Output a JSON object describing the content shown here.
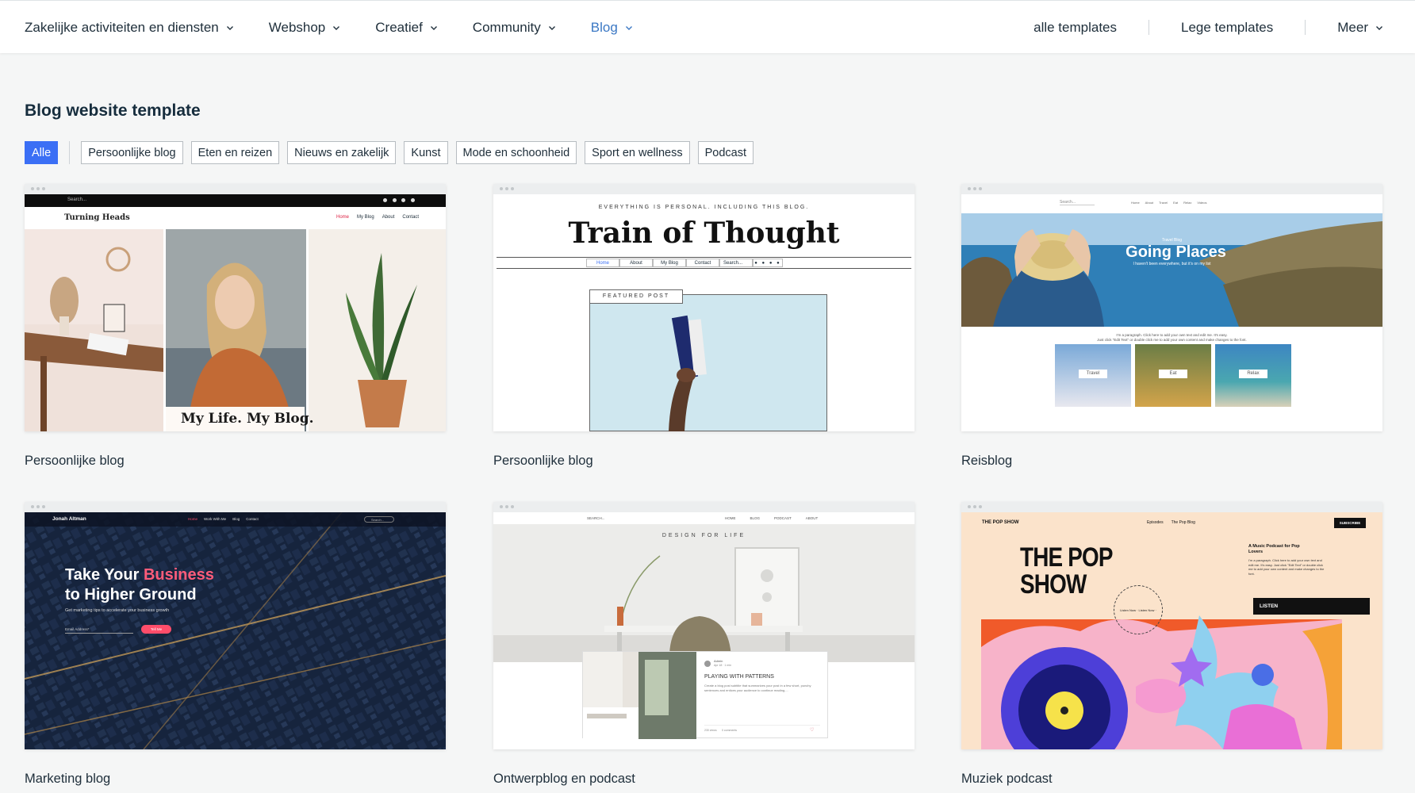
{
  "nav": {
    "items": [
      {
        "label": "Zakelijke activiteiten en diensten"
      },
      {
        "label": "Webshop"
      },
      {
        "label": "Creatief"
      },
      {
        "label": "Community"
      },
      {
        "label": "Blog"
      }
    ],
    "active_index": 4,
    "right": {
      "all_templates": "alle templates",
      "blank_templates": "Lege templates",
      "more": "Meer"
    }
  },
  "colors": {
    "active_nav": "#3b78c4",
    "selected_chip": "#3b6ff5",
    "page_bg": "#f5f6f6"
  },
  "page": {
    "title": "Blog website template"
  },
  "filters": {
    "selected": "Alle",
    "items": [
      "Persoonlijke blog",
      "Eten en reizen",
      "Nieuws en zakelijk",
      "Kunst",
      "Mode en schoonheid",
      "Sport en wellness",
      "Podcast"
    ]
  },
  "templates": [
    {
      "label": "Persoonlijke blog",
      "preview": {
        "search": "Search...",
        "site_name": "Turning Heads",
        "menu": [
          "Home",
          "My Blog",
          "About",
          "Contact"
        ],
        "tagline": "My Life. My Blog."
      }
    },
    {
      "label": "Persoonlijke blog",
      "preview": {
        "kicker": "EVERYTHING IS PERSONAL. INCLUDING THIS BLOG.",
        "title": "Train of Thought",
        "menu": [
          "Home",
          "About",
          "My Blog",
          "Contact",
          "Search..."
        ],
        "featured": "FEATURED POST"
      }
    },
    {
      "label": "Reisblog",
      "preview": {
        "search": "Search...",
        "menu": [
          "Home",
          "About",
          "Travel",
          "Eat",
          "Relax",
          "Videos"
        ],
        "small": "Travel Blog",
        "title": "Going Places",
        "subtitle": "I haven't been everywhere, but it's on my list",
        "paragraph_1": "I'm a paragraph. Click here to add your own text and edit me. It's easy.",
        "paragraph_2": "Just click \"Edit Text\" or double click me to add your own content and make changes to the font.",
        "tiles": [
          "Travel",
          "Eat",
          "Relax"
        ]
      }
    },
    {
      "label": "Marketing blog",
      "preview": {
        "name": "Jonah Altman",
        "menu": [
          "Home",
          "Work With Me",
          "Blog",
          "Contact"
        ],
        "search": "Search...",
        "headline_1": "Take Your ",
        "headline_highlight": "Business",
        "headline_2": "to Higher Ground",
        "sub": "Get marketing tips to accelerate your business growth",
        "email": "Email Address*",
        "button": "Tell Me"
      }
    },
    {
      "label": "Ontwerpblog en podcast",
      "preview": {
        "search": "SEARCH...",
        "menu": [
          "HOME",
          "BLOG",
          "PODCAST",
          "ABOUT"
        ],
        "title": "DESIGN FOR LIFE",
        "author": "Admin",
        "date": "Apr 18 · 1 min",
        "post_title": "PLAYING WITH PATTERNS",
        "post_excerpt": "Create a blog post subtitle that summarizes your post in a few short, punchy sentences and entices your audience to continue reading....",
        "views": "230 views",
        "comments": "0 comments"
      }
    },
    {
      "label": "Muziek podcast",
      "preview": {
        "brand": "THE POP SHOW",
        "menu": [
          "Episodes",
          "The Pop Blog"
        ],
        "subscribe": "SUBSCRIBE",
        "title_1": "THE POP",
        "title_2": "SHOW",
        "heading": "A Music Podcast for Pop Lovers",
        "text": "I'm a paragraph. Click here to add your own text and edit me. It's easy. Just click \"Edit Text\" or double click me to add your own content and make changes to the font.",
        "listen": "LISTEN",
        "circle_text": "Listen Now · Listen Now · "
      }
    }
  ]
}
